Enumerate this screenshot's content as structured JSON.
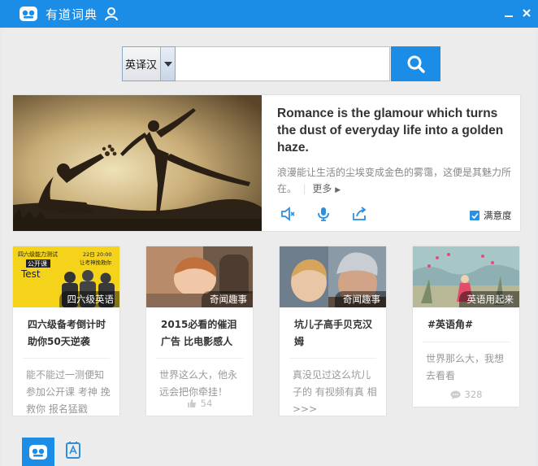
{
  "app": {
    "title": "有道词典"
  },
  "search": {
    "lang_label": "英译汉",
    "value": ""
  },
  "hero": {
    "en": "Romance is the glamour which turns the dust of everyday life into a golden haze.",
    "cn": "浪漫能让生活的尘埃变成金色的雾霭，这便是其魅力所在。",
    "more": "更多",
    "satisfaction": "满意度"
  },
  "cards": [
    {
      "tag": "四六级英语",
      "title": "四六级备考倒计时 助你50天逆袭",
      "desc": "能不能过一测便知 参加公开课 考神 挽救你 报名猛戳",
      "count": "",
      "thumb": {
        "heading": "四六级能力测试",
        "badge": "公开课",
        "word": "Test",
        "date": "22日 20:00",
        "slogan": "让考神挽救你"
      }
    },
    {
      "tag": "奇闻趣事",
      "title": "2015必看的催泪 广告 比电影感人",
      "desc": "世界这么大，他永 远会把你牵挂！",
      "count": "54"
    },
    {
      "tag": "奇闻趣事",
      "title": "坑儿子高手贝克汉 姆",
      "desc": "真没见过这么坑儿 子的 有视频有真 相>>>",
      "count": ""
    },
    {
      "tag": "英语用起来",
      "title": "#英语角#",
      "desc": "世界那么大，我想 去看看",
      "count": "328"
    }
  ],
  "colors": {
    "accent": "#1b8de6",
    "background": "#ececec"
  }
}
